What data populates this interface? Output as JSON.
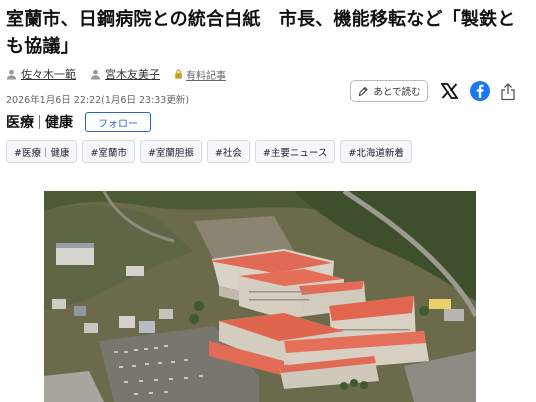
{
  "article": {
    "headline": "室蘭市、日鋼病院との統合白紙　市長、機能移転など「製鉄とも協議」",
    "authors": [
      {
        "name": "佐々木一範",
        "icon": "person-icon"
      },
      {
        "name": "宮木友美子",
        "icon": "person-icon"
      }
    ],
    "paid_label": "有料記事",
    "timestamp": "2026年1月6日 22:22(1月6日 23:33更新)"
  },
  "actions": {
    "read_later_label": "あとで読む",
    "icons": [
      "bookmark-icon",
      "x-logo-icon",
      "facebook-icon",
      "share-icon"
    ]
  },
  "topic": {
    "primary": "医療",
    "secondary": "健康",
    "follow_label": "フォロー"
  },
  "tags": [
    "#医療｜健康",
    "#室蘭市",
    "#室蘭胆振",
    "#社会",
    "#主要ニュース",
    "#北海道新着"
  ],
  "colors": {
    "accent": "#2a63c9",
    "facebook": "#1877f2"
  }
}
